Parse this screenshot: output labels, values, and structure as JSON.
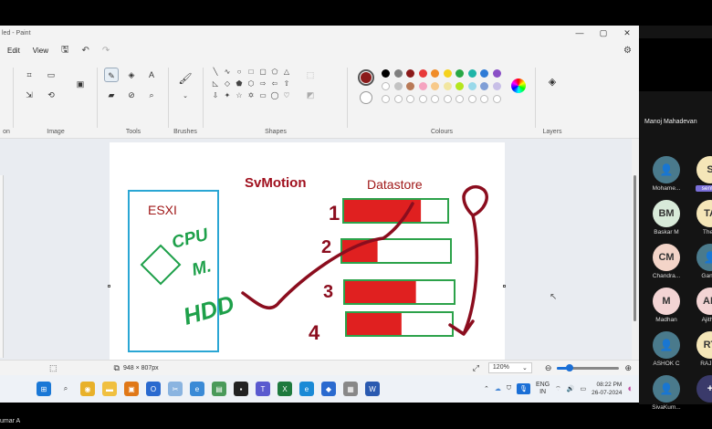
{
  "window": {
    "title": "led - Paint",
    "minimize": "—",
    "maximize": "▢",
    "close": "✕"
  },
  "menu": {
    "edit": "Edit",
    "view": "View"
  },
  "ribbon": {
    "groups": {
      "selection": "on",
      "image": "Image",
      "tools": "Tools",
      "brushes": "Brushes",
      "shapes": "Shapes",
      "colours": "Colours",
      "layers": "Layers"
    },
    "colours": {
      "selected": "#8b1a1a",
      "palette_row1": [
        "#000000",
        "#7f7f7f",
        "#8b1a1a",
        "#e83a3a",
        "#f08c28",
        "#f5d21e",
        "#28a745",
        "#1fb5a8",
        "#2e7bd6",
        "#8a4fc6"
      ],
      "palette_row2": [
        "#ffffff",
        "#c3c3c3",
        "#b97a57",
        "#f5a3c0",
        "#f7c98a",
        "#f2e6a0",
        "#b5e61d",
        "#99d9ea",
        "#7f9ed6",
        "#c8bfe7"
      ]
    }
  },
  "drawing": {
    "title": "SvMotion",
    "datastore_label": "Datastore",
    "host_label": "ESXI",
    "handwriting": {
      "line1": "CPU",
      "line2": "M.",
      "line3": "HDD"
    },
    "row_numbers": [
      "1",
      "2",
      "3",
      "4"
    ],
    "colors": {
      "host_border": "#2aa6d4",
      "disk_border": "#2ca24a",
      "disk_fill": "#e02020",
      "ink_maroon": "#8b0d1e",
      "ink_green": "#1ea04a",
      "title_color": "#a0101e"
    },
    "disks": [
      {
        "fill": 0.74
      },
      {
        "fill": 0.33
      },
      {
        "fill": 0.65
      },
      {
        "fill": 0.52
      }
    ]
  },
  "status": {
    "size": "948 × 807px",
    "zoom": "120%"
  },
  "taskbar": {
    "lang_line1": "ENG",
    "lang_line2": "IN",
    "time": "08:22 PM",
    "date": "26-07-2024"
  },
  "meeting": {
    "host": "Manoj Mahadevan",
    "participants": [
      {
        "initials": "",
        "name": "Mohame...",
        "bg": "#4a7a8c"
      },
      {
        "initials": "S",
        "name": "senthil",
        "bg": "#f5e6b8",
        "highlight": true
      },
      {
        "initials": "BM",
        "name": "Baskar M",
        "bg": "#d8ead9"
      },
      {
        "initials": "TA",
        "name": "Theni",
        "bg": "#f5e6b8"
      },
      {
        "initials": "CM",
        "name": "Chandra...",
        "bg": "#f3d4c8"
      },
      {
        "initials": "",
        "name": "Ganes",
        "bg": "#4a7a8c"
      },
      {
        "initials": "M",
        "name": "Madhan",
        "bg": "#f3d4d4"
      },
      {
        "initials": "AK",
        "name": "Ajith K",
        "bg": "#f3d4d4"
      },
      {
        "initials": "",
        "name": "ASHOK C",
        "bg": "#4a7a8c"
      },
      {
        "initials": "RT",
        "name": "RAJ Th",
        "bg": "#f5e6b8"
      },
      {
        "initials": "",
        "name": "SivaKum...",
        "bg": "#4a7a8c"
      },
      {
        "initials": "+",
        "name": "",
        "bg": "#3a3a6a"
      }
    ]
  },
  "footer": {
    "name": "umar A"
  }
}
